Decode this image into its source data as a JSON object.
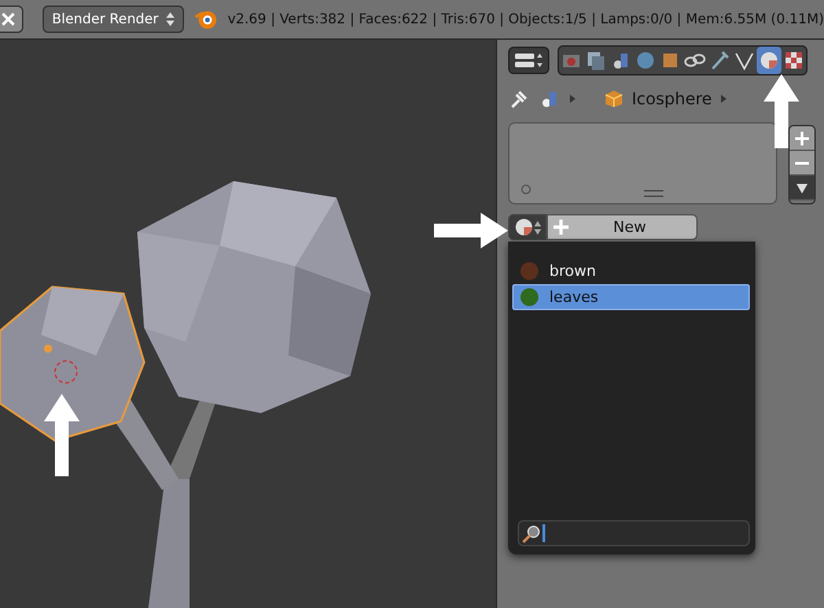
{
  "header": {
    "render_engine": "Blender Render",
    "stats": "v2.69 | Verts:382 | Faces:622 | Tris:670 | Objects:1/5 | Lamps:0/0 | Mem:6.55M (0.11M)"
  },
  "properties": {
    "tabs": [
      {
        "kind": "render",
        "selected": false
      },
      {
        "kind": "layers",
        "selected": false
      },
      {
        "kind": "scene",
        "selected": false
      },
      {
        "kind": "world",
        "selected": false
      },
      {
        "kind": "object",
        "selected": false
      },
      {
        "kind": "constraints",
        "selected": false
      },
      {
        "kind": "modifiers",
        "selected": false
      },
      {
        "kind": "data",
        "selected": false
      },
      {
        "kind": "material",
        "selected": true
      },
      {
        "kind": "texture",
        "selected": false
      }
    ],
    "breadcrumb": {
      "object": "Icosphere"
    },
    "new_button": "New",
    "material_menu": {
      "items": [
        {
          "name": "brown",
          "color": "#5a2f1c",
          "selected": false
        },
        {
          "name": "leaves",
          "color": "#2f6a1f",
          "selected": true
        }
      ]
    }
  }
}
